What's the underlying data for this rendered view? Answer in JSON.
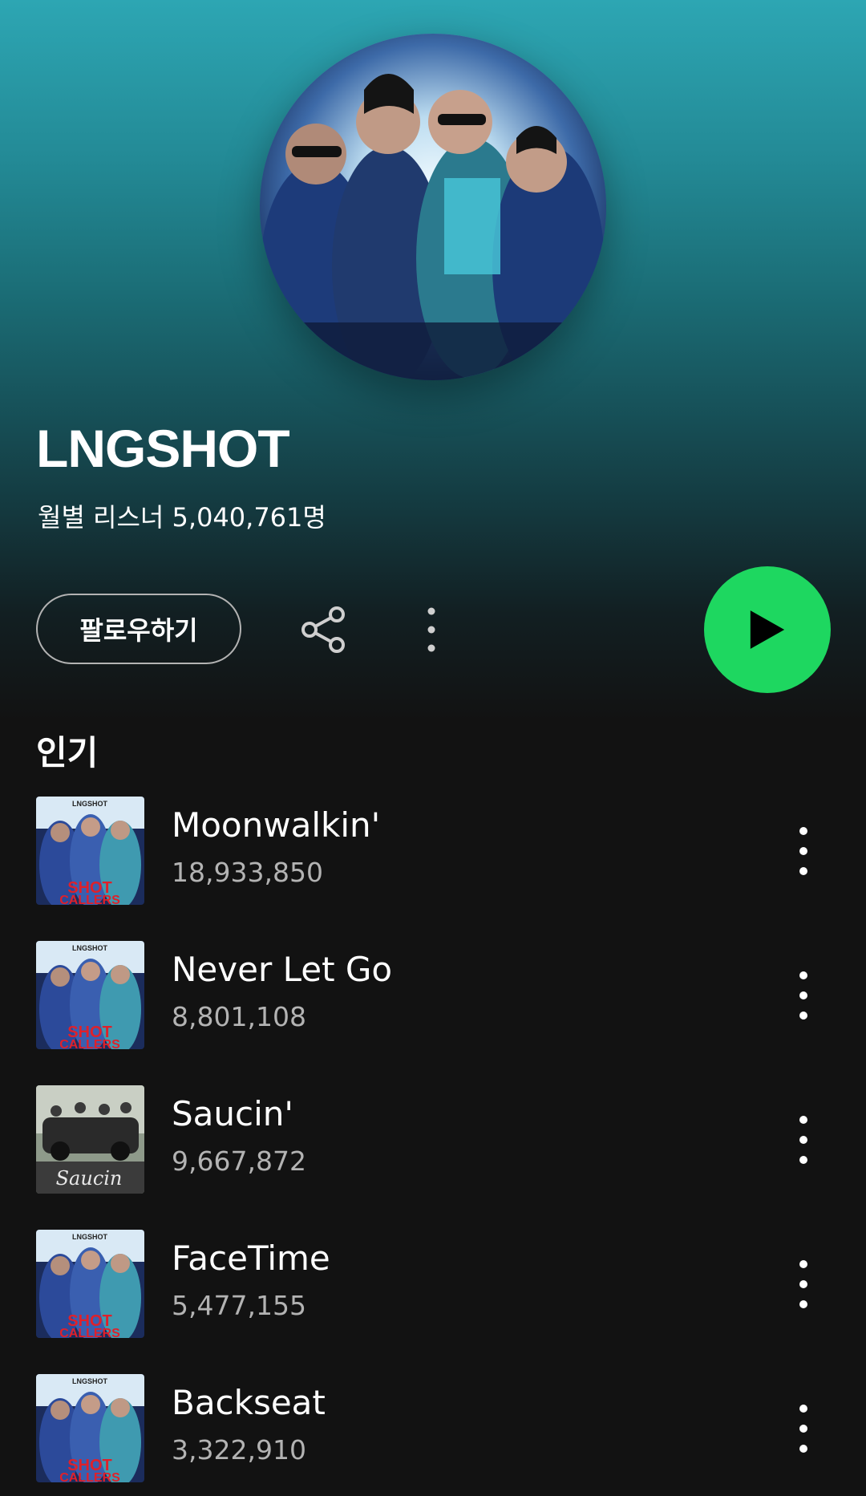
{
  "artist": {
    "name": "LNGSHOT",
    "monthly_listeners": "월별 리스너 5,040,761명"
  },
  "actions": {
    "follow_label": "팔로우하기",
    "share_icon": "share-icon",
    "more_icon": "vertical-dots-icon",
    "play_icon": "play-icon",
    "play_color": "#1ed760"
  },
  "popular": {
    "title": "인기",
    "tracks": [
      {
        "title": "Moonwalkin'",
        "plays": "18,933,850",
        "cover": "SHOT CALLERS",
        "cover_text": "LNGSHOT"
      },
      {
        "title": "Never Let Go",
        "plays": "8,801,108",
        "cover": "SHOT CALLERS",
        "cover_text": "LNGSHOT"
      },
      {
        "title": "Saucin'",
        "plays": "9,667,872",
        "cover": "Saucin'",
        "cover_text": ""
      },
      {
        "title": "FaceTime",
        "plays": "5,477,155",
        "cover": "SHOT CALLERS",
        "cover_text": "LNGSHOT"
      },
      {
        "title": "Backseat",
        "plays": "3,322,910",
        "cover": "SHOT CALLERS",
        "cover_text": "LNGSHOT"
      }
    ]
  },
  "colors": {
    "hero_top": "#2da6b3",
    "background": "#121212",
    "secondary_text": "#b3b3b3",
    "accent": "#1ed760"
  }
}
